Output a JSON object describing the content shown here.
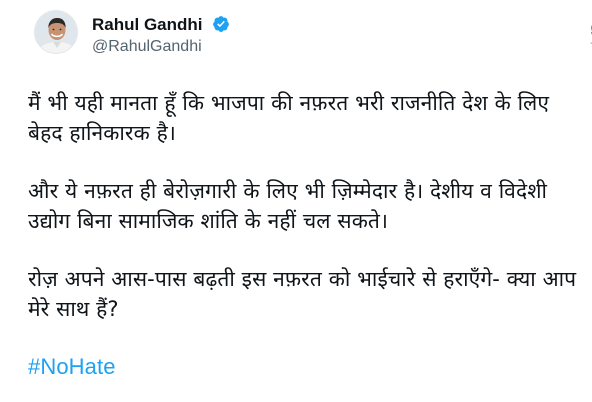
{
  "tweet": {
    "author": {
      "display_name": "Rahul Gandhi",
      "handle": "@RahulGandhi",
      "verified": true,
      "avatar_icon": "profile-photo"
    },
    "platform_icon": "twitter-bird-icon",
    "brand_color": "#1da1f2",
    "paragraphs": [
      "मैं भी यही मानता हूँ कि भाजपा की नफ़रत भरी राजनीति देश के लिए बेहद हानिकारक है।",
      "और ये नफ़रत ही बेरोज़गारी के लिए भी ज़िम्मेदार है। देशीय व विदेशी उद्योग बिना सामाजिक शांति के नहीं चल सकते।",
      "रोज़ अपने आस-पास बढ़ती इस नफ़रत को भाईचारे से हराएँगे- क्या आप मेरे साथ हैं?"
    ],
    "hashtag": "#NoHate"
  }
}
